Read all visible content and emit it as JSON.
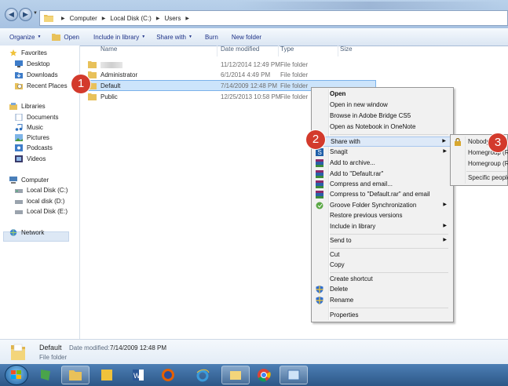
{
  "address_bar": {
    "crumbs": [
      "Computer",
      "Local Disk (C:)",
      "Users"
    ]
  },
  "toolbar": {
    "organize": "Organize",
    "open": "Open",
    "include_in_library": "Include in library",
    "share_with": "Share with",
    "burn": "Burn",
    "new_folder": "New folder"
  },
  "nav": {
    "favorites": "Favorites",
    "desktop": "Desktop",
    "downloads": "Downloads",
    "recent_places": "Recent Places",
    "libraries": "Libraries",
    "documents": "Documents",
    "music": "Music",
    "pictures": "Pictures",
    "podcasts": "Podcasts",
    "videos": "Videos",
    "computer": "Computer",
    "local_disk_c": "Local Disk (C:)",
    "local_disk_d": "local disk (D:)",
    "local_disk_e": "Local Disk (E:)",
    "network": "Network"
  },
  "columns": {
    "name": "Name",
    "date_modified": "Date modified",
    "type": "Type",
    "size": "Size"
  },
  "files": [
    {
      "name": "",
      "date": "11/12/2014 12:49 PM",
      "type": "File folder"
    },
    {
      "name": "Administrator",
      "date": "6/1/2014 4:49 PM",
      "type": "File folder"
    },
    {
      "name": "Default",
      "date": "7/14/2009 12:48 PM",
      "type": "File folder"
    },
    {
      "name": "Public",
      "date": "12/25/2013 10:58 PM",
      "type": "File folder"
    }
  ],
  "markers": [
    "1",
    "2",
    "3"
  ],
  "context_menu": {
    "open": "Open",
    "open_new_window": "Open in new window",
    "browse_bridge": "Browse in Adobe Bridge CS5",
    "open_onenote": "Open as Notebook in OneNote",
    "share_with": "Share with",
    "snagit": "Snagit",
    "add_archive": "Add to archive...",
    "add_rar": "Add to \"Default.rar\"",
    "compress_email": "Compress and email...",
    "compress_rar_email": "Compress to \"Default.rar\" and email",
    "groove": "Groove Folder Synchronization",
    "restore": "Restore previous versions",
    "include_library": "Include in library",
    "send_to": "Send to",
    "cut": "Cut",
    "copy": "Copy",
    "create_shortcut": "Create shortcut",
    "delete": "Delete",
    "rename": "Rename",
    "properties": "Properties"
  },
  "share_submenu": {
    "nobody": "Nobody",
    "homegroup_read": "Homegroup (Read)",
    "homegroup_rw": "Homegroup (Read/Write)",
    "specific_people": "Specific people..."
  },
  "details": {
    "name": "Default",
    "date_label": "Date modified:",
    "date_value": "7/14/2009 12:48 PM",
    "type": "File folder"
  },
  "colors": {
    "accent": "#3a7bd5",
    "marker": "#d33a2c",
    "selection": "#cce4fb"
  }
}
